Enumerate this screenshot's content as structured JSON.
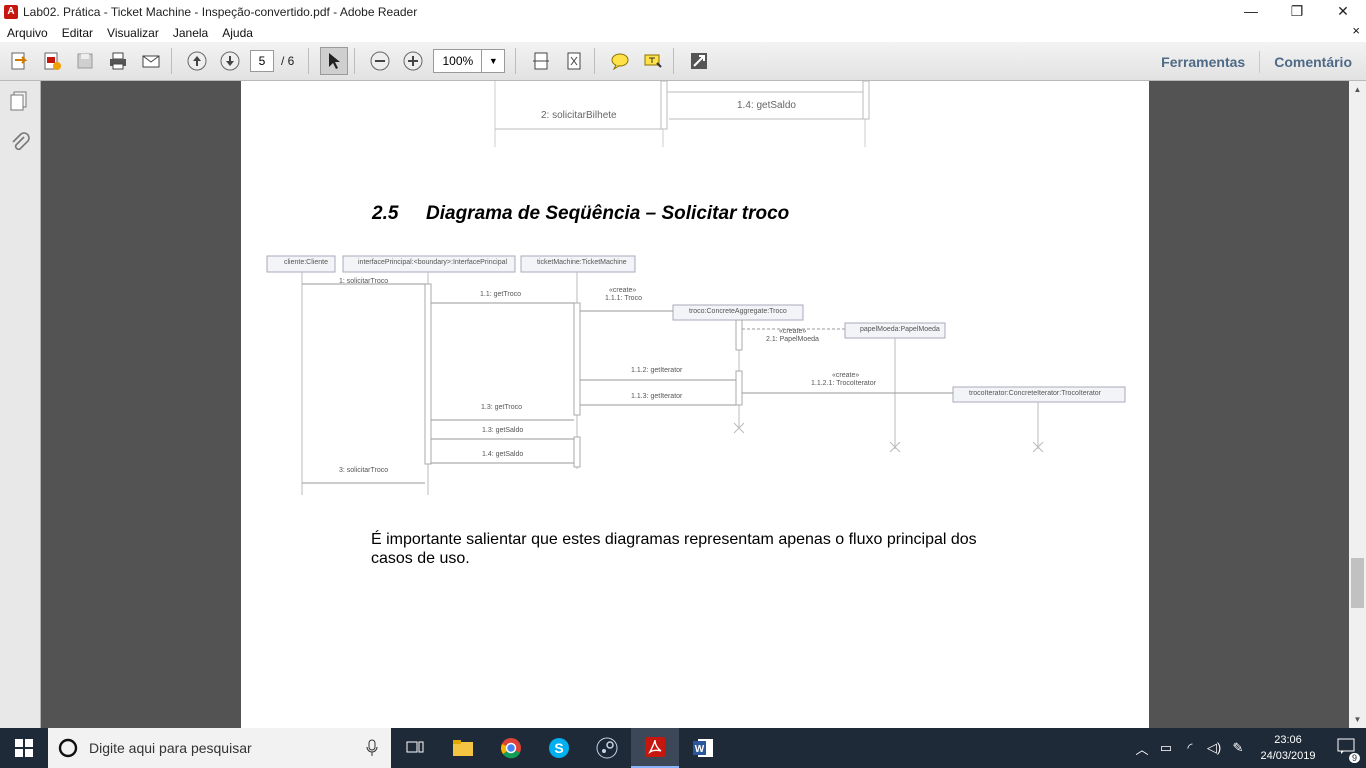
{
  "window": {
    "title": "Lab02. Prática - Ticket Machine - Inspeção-convertido.pdf - Adobe Reader",
    "minimize": "—",
    "restore": "❐",
    "close": "✕"
  },
  "menu": {
    "items": [
      "Arquivo",
      "Editar",
      "Visualizar",
      "Janela",
      "Ajuda"
    ],
    "close": "×"
  },
  "toolbar": {
    "page_current": "5",
    "page_total": "/ 6",
    "zoom": "100%",
    "tools_label": "Ferramentas",
    "comment_label": "Comentário"
  },
  "document": {
    "top_labels": {
      "solicitar_bilhete": "2: solicitarBilhete",
      "get_saldo": "1.4: getSaldo"
    },
    "heading_number": "2.5",
    "heading_title": "Diagrama de Seqüência – Solicitar troco",
    "diagram": {
      "lifelines": [
        "cliente:Cliente",
        "interfacePrincipal:<boundary>:InterfacePrincipal",
        "ticketMachine:TicketMachine",
        "troco:ConcreteAggregate:Troco",
        "papelMoeda:PapelMoeda",
        "trocoIterator:ConcreteIterator:TrocoIterator"
      ],
      "messages": [
        "1: solicitarTroco",
        "1.1: getTroco",
        "«create»",
        "1.1.1: Troco",
        "«create»",
        "2.1: PapelMoeda",
        "1.1.2: getIterator",
        "«create»",
        "1.1.2.1: TrocoIterator",
        "1.1.3: getIterator",
        "1.3: getTroco",
        "1.3: getSaldo",
        "1.4: getSaldo",
        "3: solicitarTroco"
      ]
    },
    "body_text": "É importante salientar que estes diagramas representam apenas o fluxo principal dos casos de uso."
  },
  "taskbar": {
    "search_placeholder": "Digite aqui para pesquisar",
    "time": "23:06",
    "date": "24/03/2019",
    "notification_count": "9"
  }
}
